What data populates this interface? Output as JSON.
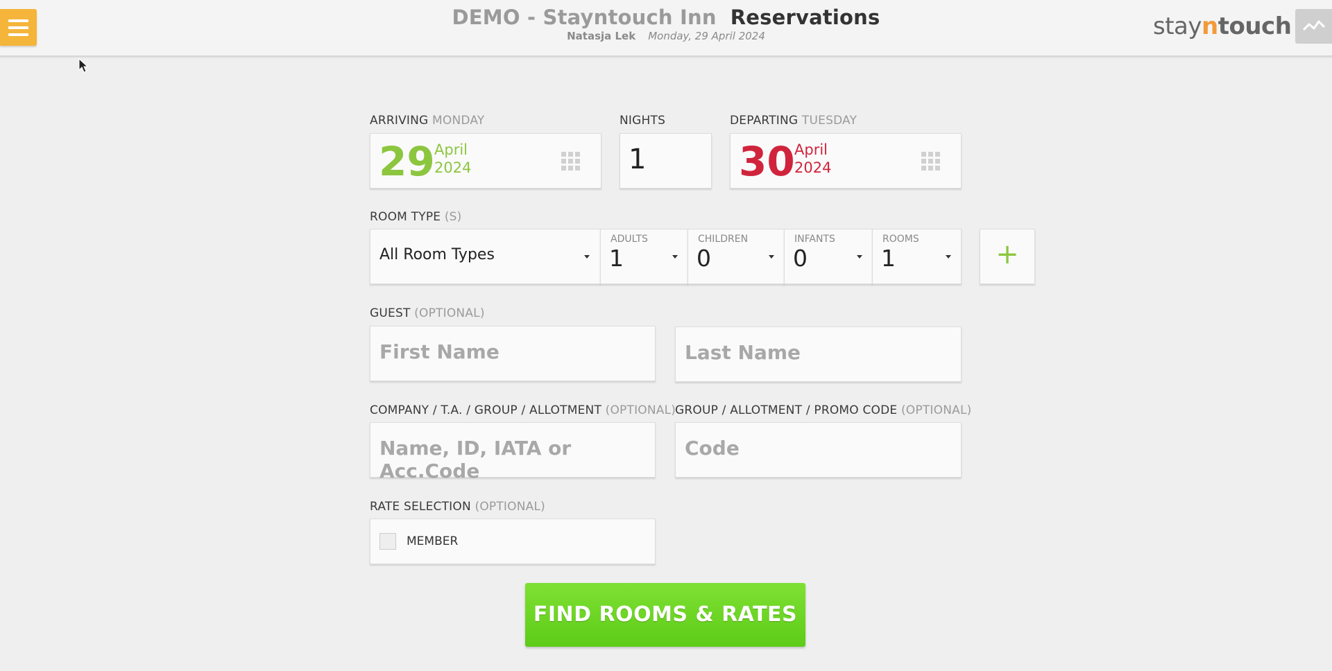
{
  "header": {
    "hotel_name": "DEMO - Stayntouch Inn",
    "page_title": "Reservations",
    "user": "Natasja Lek",
    "date": "Monday, 29 April 2024",
    "brand_pre": "stay",
    "brand_n": "n",
    "brand_post": "touch"
  },
  "arriving": {
    "label": "ARRIVING",
    "weekday": "MONDAY",
    "day": "29",
    "month": "April",
    "year": "2024"
  },
  "nights": {
    "label": "NIGHTS",
    "value": "1"
  },
  "departing": {
    "label": "DEPARTING",
    "weekday": "TUESDAY",
    "day": "30",
    "month": "April",
    "year": "2024"
  },
  "room_type": {
    "label": "ROOM TYPE",
    "label_suffix": "(S)",
    "selected": "All Room Types",
    "adults_label": "ADULTS",
    "adults": "1",
    "children_label": "CHILDREN",
    "children": "0",
    "infants_label": "INFANTS",
    "infants": "0",
    "rooms_label": "ROOMS",
    "rooms": "1",
    "add": "+"
  },
  "guest": {
    "label": "GUEST",
    "optional": "(OPTIONAL)",
    "first_placeholder": "First Name",
    "last_placeholder": "Last Name"
  },
  "company": {
    "label": "COMPANY / T.A. / GROUP / ALLOTMENT",
    "optional": "(OPTIONAL)",
    "placeholder": "Name, ID, IATA or Acc.Code"
  },
  "promo": {
    "label": "GROUP / ALLOTMENT / PROMO CODE",
    "optional": "(OPTIONAL)",
    "placeholder": "Code"
  },
  "rate": {
    "label": "RATE SELECTION",
    "optional": "(OPTIONAL)",
    "member_label": "MEMBER"
  },
  "cta_label": "FIND ROOMS & RATES",
  "colors": {
    "accent_green": "#8cc63f",
    "depart_red": "#d0243c",
    "menu_orange": "#f5b53a",
    "cta_green": "#66d321"
  }
}
